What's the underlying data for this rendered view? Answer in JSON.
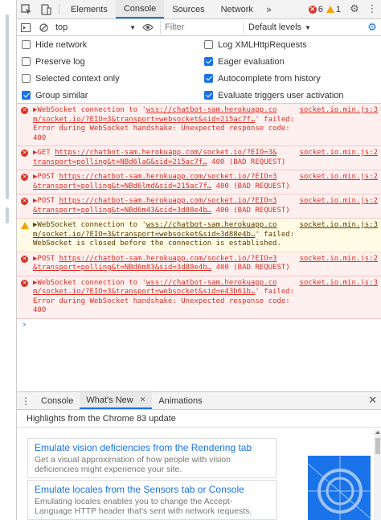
{
  "tabbar": {
    "tabs": [
      "Elements",
      "Console",
      "Sources",
      "Network"
    ],
    "more": "»",
    "error_count": "6",
    "warning_count": "1"
  },
  "console_toolbar": {
    "context": "top",
    "filter_placeholder": "Filter",
    "levels": "Default levels"
  },
  "settings": {
    "left": [
      {
        "label": "Hide network",
        "checked": false
      },
      {
        "label": "Preserve log",
        "checked": false
      },
      {
        "label": "Selected context only",
        "checked": false
      },
      {
        "label": "Group similar",
        "checked": true
      }
    ],
    "right": [
      {
        "label": "Log XMLHttpRequests",
        "checked": false
      },
      {
        "label": "Eager evaluation",
        "checked": true
      },
      {
        "label": "Autocomplete from history",
        "checked": true
      },
      {
        "label": "Evaluate triggers user activation",
        "checked": true
      }
    ]
  },
  "messages": [
    {
      "level": "error",
      "pre": "▶WebSocket connection to '",
      "link": "wss://chatbot-sam.herokuapp.co m/socket.io/?EIO=3&transport=websocket&sid=215ac7f…",
      "post": "' failed: Error during WebSocket handshake: Unexpected response code: 400",
      "source": "socket.io.min.js:3"
    },
    {
      "level": "error",
      "pre": "▶GET ",
      "link": "https://chatbot-sam.herokuapp.com/socket.io/?EIO=3& transport=polling&t=NBd6laG&sid=215ac7f…",
      "post": " 400 (BAD REQUEST)",
      "source": "socket.io.min.js:2"
    },
    {
      "level": "error",
      "pre": "▶POST ",
      "link": "https://chatbot-sam.herokuapp.com/socket.io/?EIO=3 &transport=polling&t=NBd6lmd&sid=215ac7f…",
      "post": " 400 (BAD REQUEST)",
      "source": "socket.io.min.js:2"
    },
    {
      "level": "error",
      "pre": "▶POST ",
      "link": "https://chatbot-sam.herokuapp.com/socket.io/?EIO=3 &transport=polling&t=NBd6m43&sid=3d88e4b…",
      "post": " 400 (BAD REQUEST)",
      "source": "socket.io.min.js:2"
    },
    {
      "level": "warning",
      "pre": "▶WebSocket connection to '",
      "link": "wss://chatbot-sam.herokuapp.co m/socket.io/?EIO=3&transport=websocket&sid=3d88e4b…",
      "post": "' failed: WebSocket is closed before the connection is established.",
      "source": "socket.io.min.js:3"
    },
    {
      "level": "error",
      "pre": "▶POST ",
      "link": "https://chatbot-sam.herokuapp.com/socket.io/?EIO=3 &transport=polling&t=NBd6m83&sid=3d88e4b…",
      "post": " 400 (BAD REQUEST)",
      "source": "socket.io.min.js:2"
    },
    {
      "level": "error",
      "pre": "▶WebSocket connection to '",
      "link": "wss://chatbot-sam.herokuapp.co m/socket.io/?EIO=3&transport=websocket&sid=e43b61b…",
      "post": "' failed: Error during WebSocket handshake: Unexpected response code: 400",
      "source": "socket.io.min.js:3"
    }
  ],
  "prompt": "›",
  "drawer": {
    "tabs": [
      "Console",
      "What's New",
      "Animations"
    ],
    "tab_close": "✕",
    "close": "✕",
    "highlights": "Highlights from the Chrome 83 update",
    "cards": [
      {
        "title": "Emulate vision deficiencies from the Rendering tab",
        "desc": "Get a visual approximation of how people with vision deficiencies might experience your site."
      },
      {
        "title": "Emulate locales from the Sensors tab or Console",
        "desc": "Emulating locales enables you to change the Accept-Language HTTP header that's sent with network requests."
      }
    ]
  },
  "colors": {
    "accent": "#1a73e8",
    "error": "#d93025",
    "error_bg": "#fff0f0",
    "warning": "#f0a30a",
    "warning_bg": "#fffbe5"
  }
}
